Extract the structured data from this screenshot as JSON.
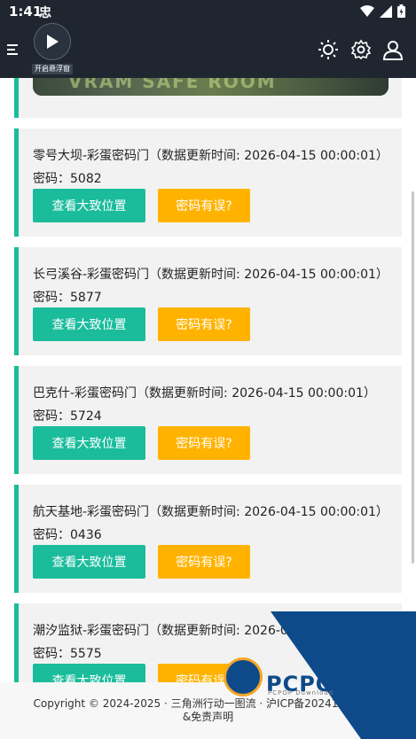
{
  "status": {
    "time": "1:41",
    "app_glyph": "忠"
  },
  "appbar": {
    "float_label": "开启悬浮窗"
  },
  "banner": {
    "text": "VRAM SAFE ROOM"
  },
  "cards": [
    {
      "title": "零号大坝-彩蛋密码门（数据更新时间: 2026-04-15 00:00:01）",
      "code": "密码：5082",
      "btn_location": "查看大致位置",
      "btn_error": "密码有误?"
    },
    {
      "title": "长弓溪谷-彩蛋密码门（数据更新时间: 2026-04-15 00:00:01）",
      "code": "密码：5877",
      "btn_location": "查看大致位置",
      "btn_error": "密码有误?"
    },
    {
      "title": "巴克什-彩蛋密码门（数据更新时间: 2026-04-15 00:00:01）",
      "code": "密码：5724",
      "btn_location": "查看大致位置",
      "btn_error": "密码有误?"
    },
    {
      "title": "航天基地-彩蛋密码门（数据更新时间: 2026-04-15 00:00:01）",
      "code": "密码：0436",
      "btn_location": "查看大致位置",
      "btn_error": "密码有误?"
    },
    {
      "title": "潮汐监狱-彩蛋密码门（数据更新时间: 2026-04-15 00:00:01）",
      "code": "密码：5575",
      "btn_location": "查看大致位置",
      "btn_error": "密码有误?"
    }
  ],
  "footer": {
    "line1": "Copyright © 2024-2025 · 三角洲行动一图流 · 沪ICP备2024102033号",
    "line2": "&免责声明"
  },
  "watermark": {
    "brand": "PCPOP下载",
    "sub": "PCPOP Download"
  },
  "colors": {
    "accent": "#1abc9c",
    "warning": "#ffb300",
    "header": "#1f2630",
    "card": "#f2f2f2"
  }
}
